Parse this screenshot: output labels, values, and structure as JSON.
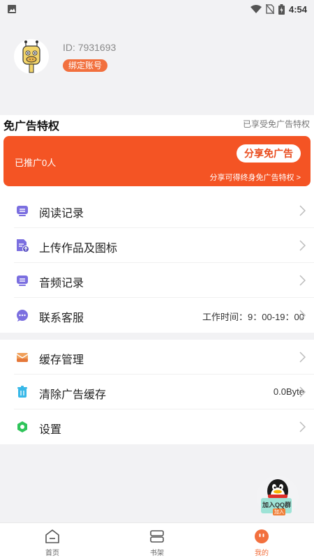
{
  "status_bar": {
    "time": "4:54"
  },
  "profile": {
    "id_text": "ID: 7931693",
    "bind_label": "绑定账号"
  },
  "adfree": {
    "title": "免广告特权",
    "status": "已享受免广告特权",
    "promoted": "已推广0人",
    "share_button": "分享免广告",
    "share_note": "分享可得终身免广告特权 >"
  },
  "menu_group_1": [
    {
      "label": "阅读记录",
      "icon": "reading-record-icon"
    },
    {
      "label": "上传作品及图标",
      "icon": "upload-doc-icon"
    },
    {
      "label": "音频记录",
      "icon": "audio-record-icon"
    },
    {
      "label": "联系客服",
      "icon": "chat-bubble-icon",
      "extra": "工作时间：9：00-19：00"
    }
  ],
  "menu_group_2": [
    {
      "label": "缓存管理",
      "icon": "cache-box-icon"
    },
    {
      "label": "清除广告缓存",
      "icon": "trash-icon",
      "extra": "0.0Byte"
    },
    {
      "label": "设置",
      "icon": "settings-icon"
    }
  ],
  "qq_float": {
    "label": "加入QQ群",
    "sub": "加入"
  },
  "tabs": [
    {
      "label": "首页",
      "icon": "home-icon",
      "active": false
    },
    {
      "label": "书架",
      "icon": "bookshelf-icon",
      "active": false
    },
    {
      "label": "我的",
      "icon": "profile-face-icon",
      "active": true
    }
  ],
  "colors": {
    "accent": "#f45424",
    "tab_active": "#f2703e",
    "menu_icon_purple": "#7b6fe0"
  }
}
